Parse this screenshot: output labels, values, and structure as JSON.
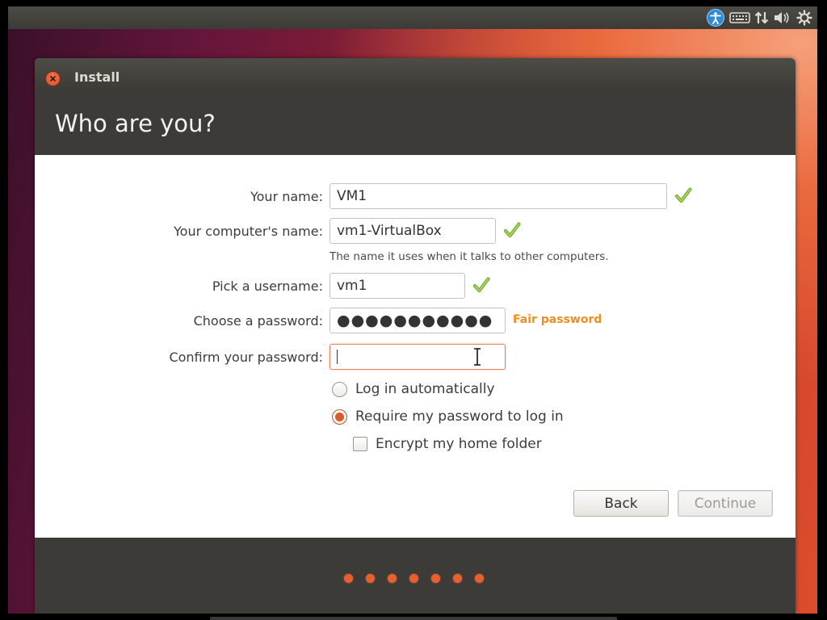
{
  "window": {
    "title": "Install",
    "page_title": "Who are you?"
  },
  "form": {
    "name_label": "Your name:",
    "name_value": "VM1",
    "computer_label": "Your computer's name:",
    "computer_value": "vm1-VirtualBox",
    "computer_hint": "The name it uses when it talks to other computers.",
    "username_label": "Pick a username:",
    "username_value": "vm1",
    "password_label": "Choose a password:",
    "password_masked": "●●●●●●●●●●●",
    "password_strength": "Fair password",
    "confirm_label": "Confirm your password:",
    "confirm_value": "",
    "login_auto_label": "Log in automatically",
    "login_auto_selected": false,
    "require_password_label": "Require my password to log in",
    "require_password_selected": true,
    "encrypt_label": "Encrypt my home folder",
    "encrypt_checked": false
  },
  "buttons": {
    "back": "Back",
    "continue": "Continue",
    "continue_enabled": false
  },
  "progress": {
    "steps": 7
  },
  "icons": {
    "tray": [
      "accessibility-icon",
      "keyboard-icon",
      "network-icon",
      "volume-icon",
      "gear-icon"
    ],
    "valid": "checkmark-icon"
  },
  "colors": {
    "accent": "#dd4814",
    "strength_fair": "#f28c1a",
    "check_green": "#8dc63f",
    "panel_dark": "#3c3b37"
  }
}
